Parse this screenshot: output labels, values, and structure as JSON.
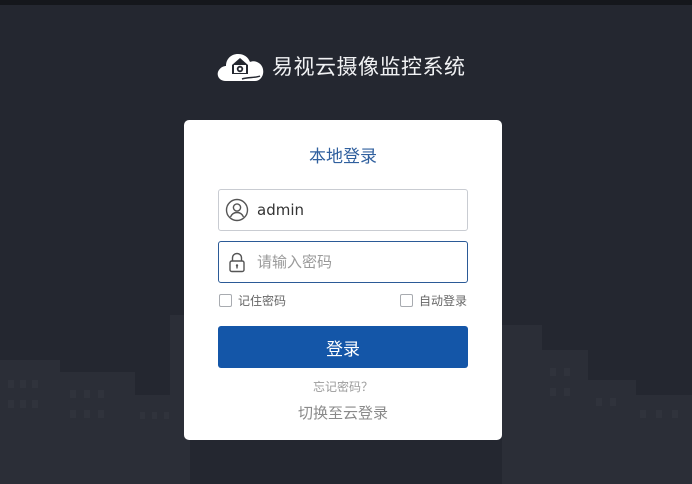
{
  "header": {
    "title": "易视云摄像监控系统",
    "logo_icon": "cloud-camera-logo"
  },
  "login": {
    "title": "本地登录",
    "username": {
      "value": "admin",
      "icon": "user-icon"
    },
    "password": {
      "value": "",
      "placeholder": "请输入密码",
      "icon": "lock-icon"
    },
    "remember_password": {
      "label": "记住密码",
      "checked": false
    },
    "auto_login": {
      "label": "自动登录",
      "checked": false
    },
    "submit_label": "登录",
    "forgot_label": "忘记密码？",
    "switch_label": "切换至云登录"
  },
  "colors": {
    "background": "#242730",
    "primary": "#1456a8",
    "title": "#2f5f9e"
  }
}
